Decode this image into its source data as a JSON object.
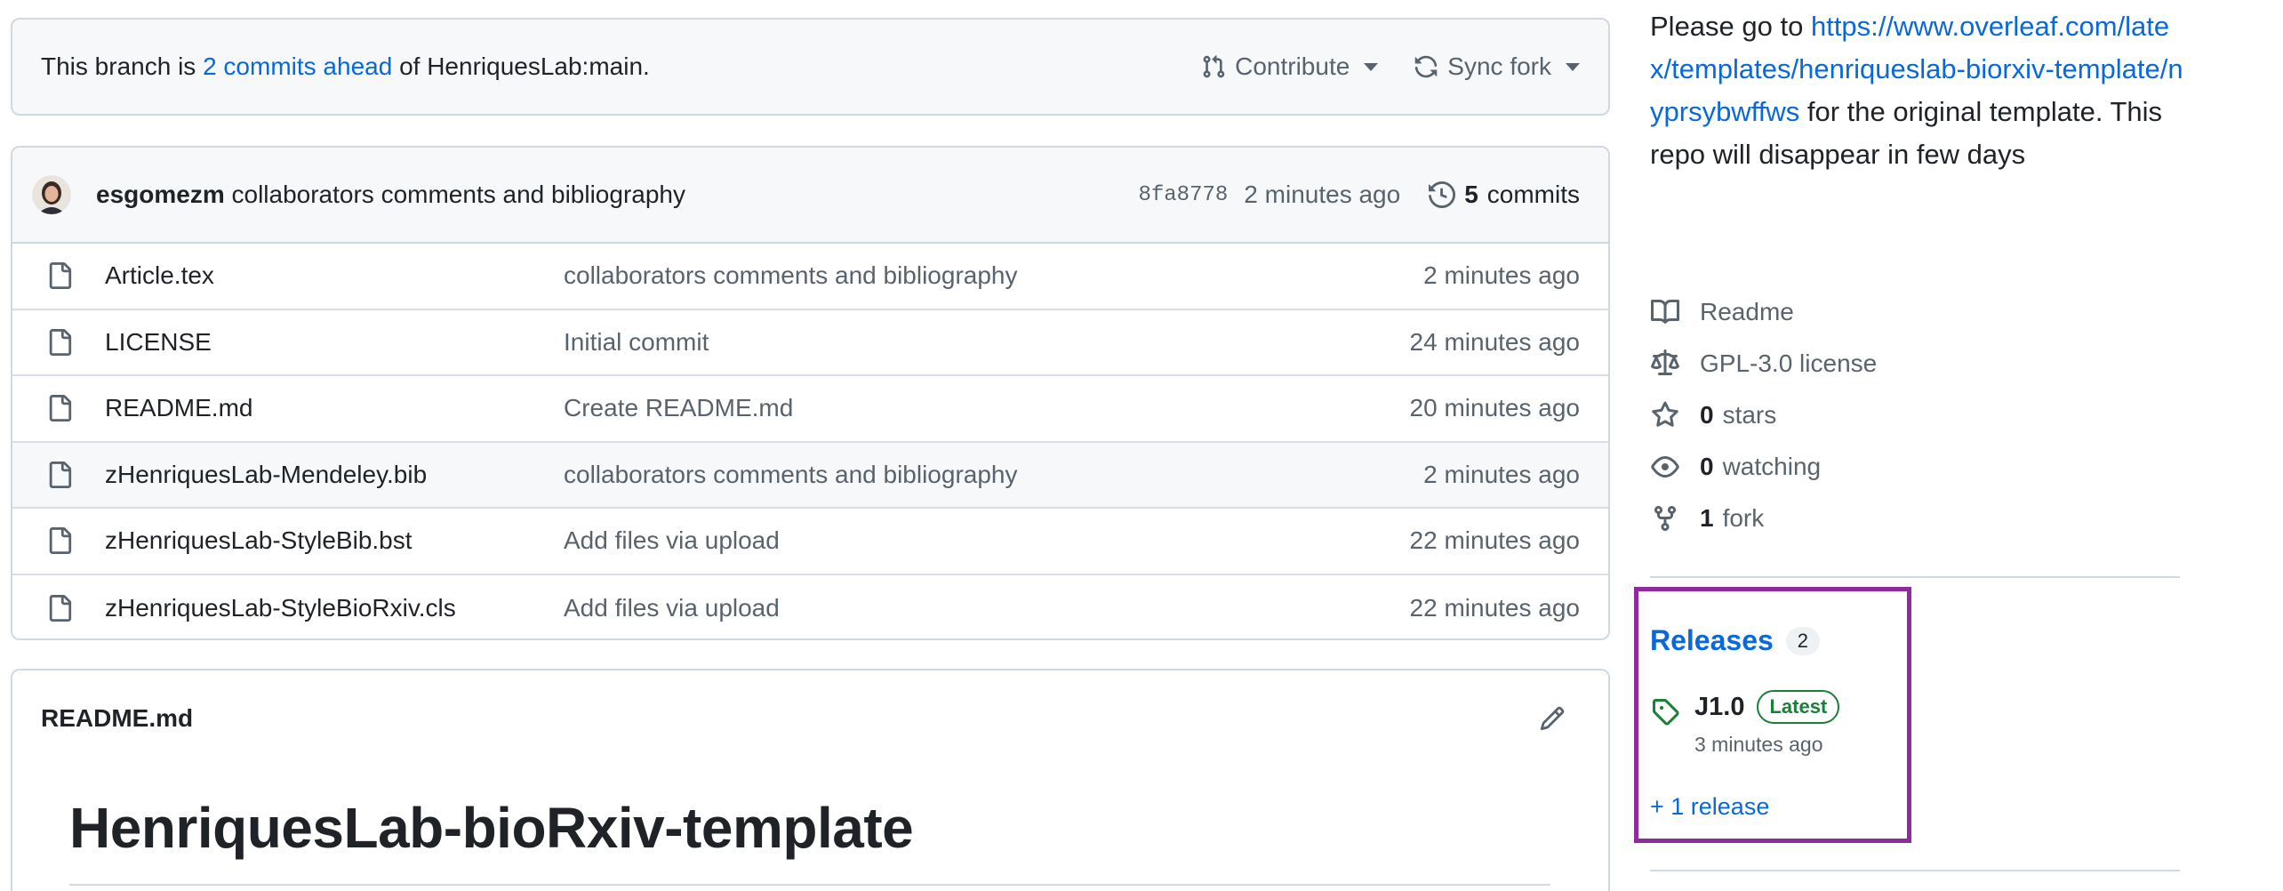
{
  "banner": {
    "prefix": "This branch is ",
    "ahead_link": "2 commits ahead",
    "suffix": " of HenriquesLab:main.",
    "contribute_label": "Contribute",
    "sync_label": "Sync fork"
  },
  "latest_commit": {
    "author": "esgomezm",
    "message": "collaborators comments and bibliography",
    "sha": "8fa8778",
    "time": "2 minutes ago",
    "commit_count": "5",
    "commits_label": "commits"
  },
  "files": [
    {
      "name": "Article.tex",
      "message": "collaborators comments and bibliography",
      "time": "2 minutes ago"
    },
    {
      "name": "LICENSE",
      "message": "Initial commit",
      "time": "24 minutes ago"
    },
    {
      "name": "README.md",
      "message": "Create README.md",
      "time": "20 minutes ago"
    },
    {
      "name": "zHenriquesLab-Mendeley.bib",
      "message": "collaborators comments and bibliography",
      "time": "2 minutes ago"
    },
    {
      "name": "zHenriquesLab-StyleBib.bst",
      "message": "Add files via upload",
      "time": "22 minutes ago"
    },
    {
      "name": "zHenriquesLab-StyleBioRxiv.cls",
      "message": "Add files via upload",
      "time": "22 minutes ago"
    }
  ],
  "readme": {
    "file_label": "README.md",
    "heading": "HenriquesLab-bioRxiv-template"
  },
  "about": {
    "lead": "Please go to ",
    "link": "https://www.overleaf.com/latex/templates/henriqueslab-biorxiv-template/nyprsybwffws",
    "tail": " for the original template. This repo will disappear in few days"
  },
  "meta": {
    "readme": "Readme",
    "license": "GPL-3.0 license",
    "stars_count": "0",
    "stars_label": "stars",
    "watching_count": "0",
    "watching_label": "watching",
    "fork_count": "1",
    "fork_label": "fork"
  },
  "releases": {
    "title": "Releases",
    "count": "2",
    "latest_name": "J1.0",
    "latest_badge": "Latest",
    "latest_time": "3 minutes ago",
    "more_link": "+ 1 release"
  },
  "colors": {
    "link": "#0969da",
    "highlight_box": "#8e2c9e",
    "latest_green": "#1a7f37"
  }
}
